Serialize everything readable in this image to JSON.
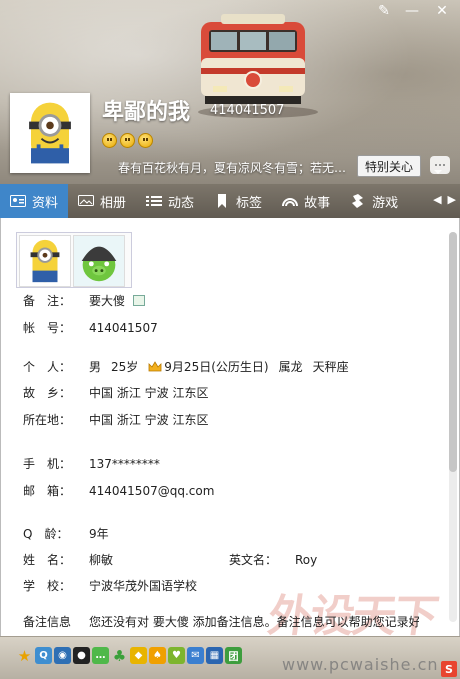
{
  "window": {
    "skin_icon": "paintbrush-icon",
    "min_icon": "minimize-icon",
    "close_icon": "close-icon"
  },
  "profile": {
    "nickname": "卑鄙的我",
    "qq": "414041507",
    "signature": "春有百花秋有月，夏有凉风冬有雪；若无闲事...",
    "care_button": "特别关心",
    "chat_icon": "chat-bubble-icon"
  },
  "tabs": [
    {
      "label": "资料",
      "icon": "profile-card-icon"
    },
    {
      "label": "相册",
      "icon": "photo-album-icon"
    },
    {
      "label": "动态",
      "icon": "feed-list-icon"
    },
    {
      "label": "标签",
      "icon": "bookmark-icon"
    },
    {
      "label": "故事",
      "icon": "story-rainbow-icon"
    },
    {
      "label": "游戏",
      "icon": "game-icon"
    }
  ],
  "info": {
    "remark_label": "备　注：",
    "remark_value": "要大傻",
    "account_label": "帐　号：",
    "account_value": "414041507",
    "person_label": "个　人：",
    "gender": "男",
    "age": "25岁",
    "birthday": "9月25日(公历生日)",
    "zodiac": "属龙",
    "constellation": "天秤座",
    "hometown_label": "故　乡：",
    "hometown_value": "中国 浙江 宁波 江东区",
    "location_label": "所在地：",
    "location_value": "中国 浙江 宁波 江东区",
    "phone_label": "手　机：",
    "phone_value": "137********",
    "email_label": "邮　箱：",
    "email_value": "414041507@qq.com",
    "qage_label": "Q　龄：",
    "qage_value": "9年",
    "name_label": "姓　名：",
    "name_value": "柳敏",
    "english_label": "英文名：",
    "english_value": "Roy",
    "school_label": "学　校：",
    "school_value": "宁波华茂外国语学校",
    "note_label": "备注信息",
    "note_placeholder": "您还没有对 要大傻 添加备注信息。备注信息可以帮助您记录好"
  },
  "watermark": "外设天下",
  "footer": {
    "url": "www.pcwaishe.cn",
    "apps": [
      "star-icon",
      "qzone-icon",
      "camera-icon",
      "penguin-icon",
      "chat-green-icon",
      "clover-icon",
      "game-icon",
      "shopping-icon",
      "pet-icon",
      "mail-icon",
      "calendar-icon",
      "group-icon"
    ],
    "logo": "S"
  }
}
